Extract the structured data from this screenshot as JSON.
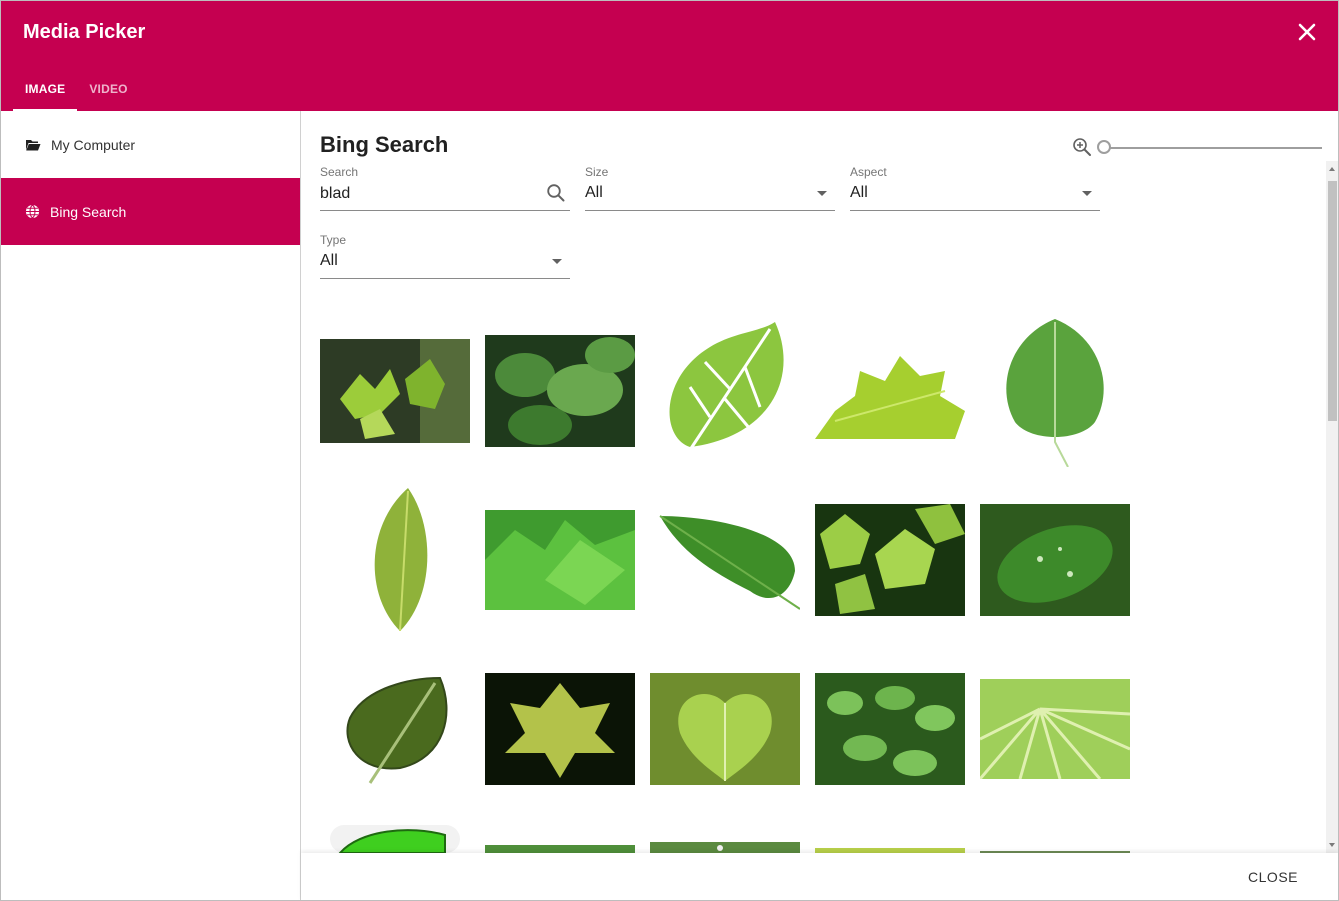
{
  "header": {
    "title": "Media Picker",
    "close_icon": "close-icon",
    "bg_color": "#c50050"
  },
  "tabs": [
    {
      "label": "IMAGE",
      "active": true
    },
    {
      "label": "VIDEO",
      "active": false
    }
  ],
  "sidebar": {
    "items": [
      {
        "label": "My Computer",
        "icon": "folder-open-icon",
        "active": false
      },
      {
        "label": "Bing Search",
        "icon": "globe-icon",
        "active": true
      }
    ]
  },
  "main": {
    "title": "Bing Search",
    "zoom_level": 0,
    "filters": {
      "search": {
        "label": "Search",
        "value": "blad"
      },
      "size": {
        "label": "Size",
        "value": "All"
      },
      "aspect": {
        "label": "Aspect",
        "value": "All"
      },
      "type": {
        "label": "Type",
        "value": "All"
      }
    },
    "results_count_visible": 20
  },
  "footer": {
    "close_label": "CLOSE"
  }
}
